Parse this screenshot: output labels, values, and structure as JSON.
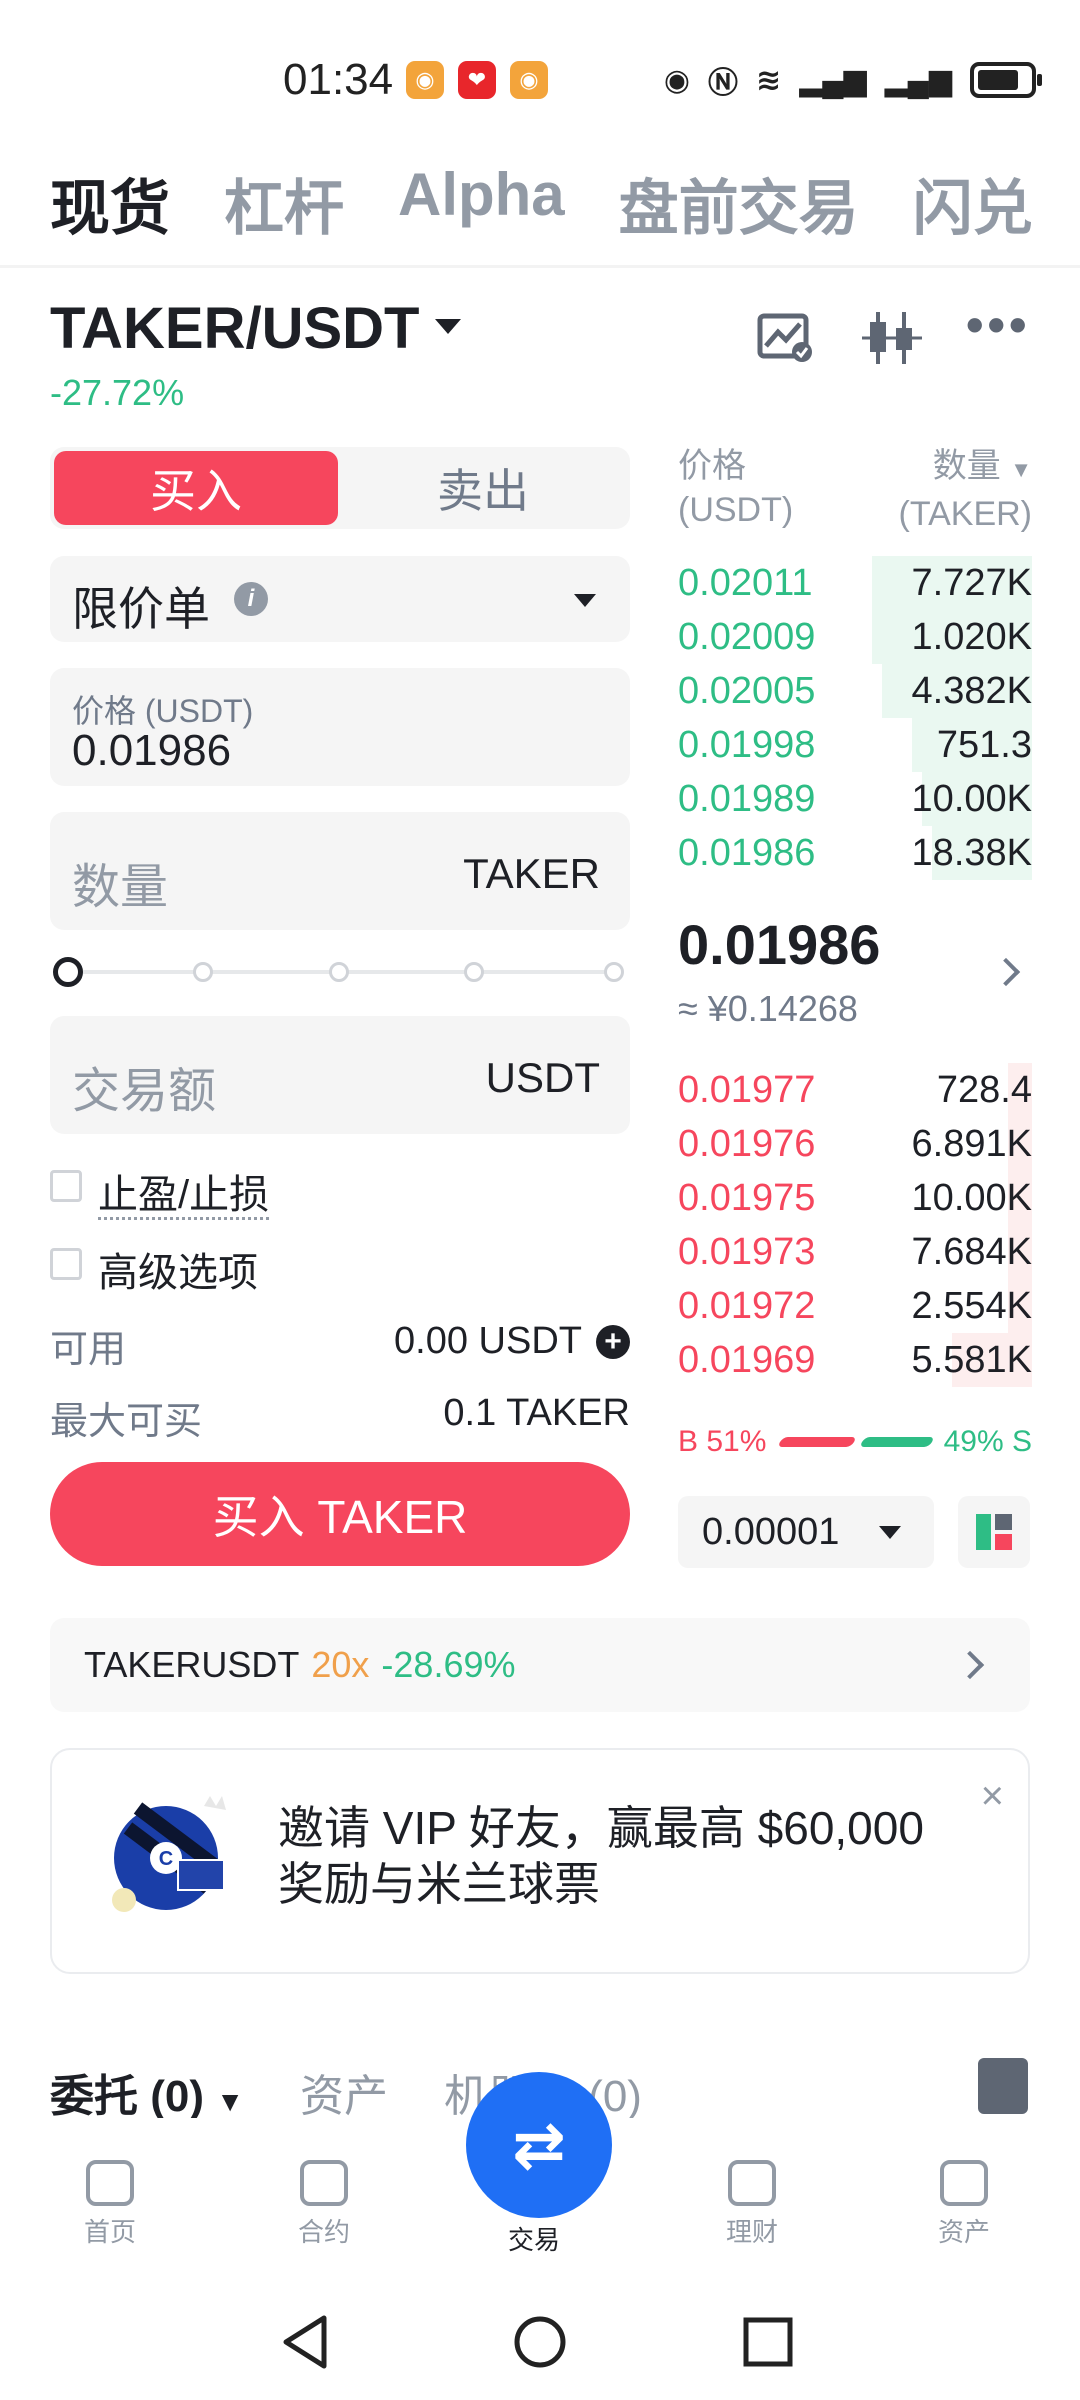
{
  "status": {
    "time": "01:34"
  },
  "top_tabs": [
    "现货",
    "杠杆",
    "Alpha",
    "盘前交易",
    "闪兑"
  ],
  "pair": {
    "symbol": "TAKER/USDT",
    "change": "-27.72%"
  },
  "side": {
    "buy": "买入",
    "sell": "卖出"
  },
  "order_type": {
    "label": "限价单",
    "info": "i"
  },
  "price": {
    "label": "价格 (USDT)",
    "value": "0.01986"
  },
  "quantity": {
    "placeholder": "数量",
    "unit": "TAKER"
  },
  "slider": {
    "value_percent": 0
  },
  "amount": {
    "placeholder": "交易额",
    "unit": "USDT"
  },
  "options": {
    "tpsl": "止盈/止损",
    "advanced": "高级选项"
  },
  "available": {
    "label": "可用",
    "value": "0.00 USDT"
  },
  "max_buy": {
    "label": "最大可买",
    "value": "0.1 TAKER"
  },
  "buy_button": "买入 TAKER",
  "orderbook": {
    "price_header": "价格",
    "price_unit": "(USDT)",
    "qty_header": "数量",
    "qty_unit": "(TAKER)",
    "asks": [
      {
        "price": "0.02011",
        "qty": "7.727K"
      },
      {
        "price": "0.02009",
        "qty": "1.020K"
      },
      {
        "price": "0.02005",
        "qty": "4.382K"
      },
      {
        "price": "0.01998",
        "qty": "751.3"
      },
      {
        "price": "0.01989",
        "qty": "10.00K"
      },
      {
        "price": "0.01986",
        "qty": "18.38K"
      }
    ],
    "last_price": "0.01986",
    "last_price_cny": "≈ ¥0.14268",
    "bids": [
      {
        "price": "0.01977",
        "qty": "728.4"
      },
      {
        "price": "0.01976",
        "qty": "6.891K"
      },
      {
        "price": "0.01975",
        "qty": "10.00K"
      },
      {
        "price": "0.01973",
        "qty": "7.684K"
      },
      {
        "price": "0.01972",
        "qty": "2.554K"
      },
      {
        "price": "0.01969",
        "qty": "5.581K"
      }
    ],
    "buy_ratio": "B 51%",
    "sell_ratio": "49% S",
    "tick": "0.00001"
  },
  "futures": {
    "symbol": "TAKERUSDT",
    "leverage": "20x",
    "change": "-28.69%"
  },
  "banner": {
    "line1": "邀请 VIP 好友，赢最高 $60,000",
    "line2": "奖励与米兰球票",
    "close": "×"
  },
  "bottom_tabs": {
    "orders": "委托 (0)",
    "assets": "资产",
    "bots": "机器人 (0)"
  },
  "nav": [
    {
      "label": "首页"
    },
    {
      "label": "合约"
    },
    {
      "label": "交易"
    },
    {
      "label": "理财"
    },
    {
      "label": "资产"
    }
  ],
  "colors": {
    "buy": "#f6465d",
    "sell": "#2ebd85",
    "fab": "#1f6ff5"
  }
}
